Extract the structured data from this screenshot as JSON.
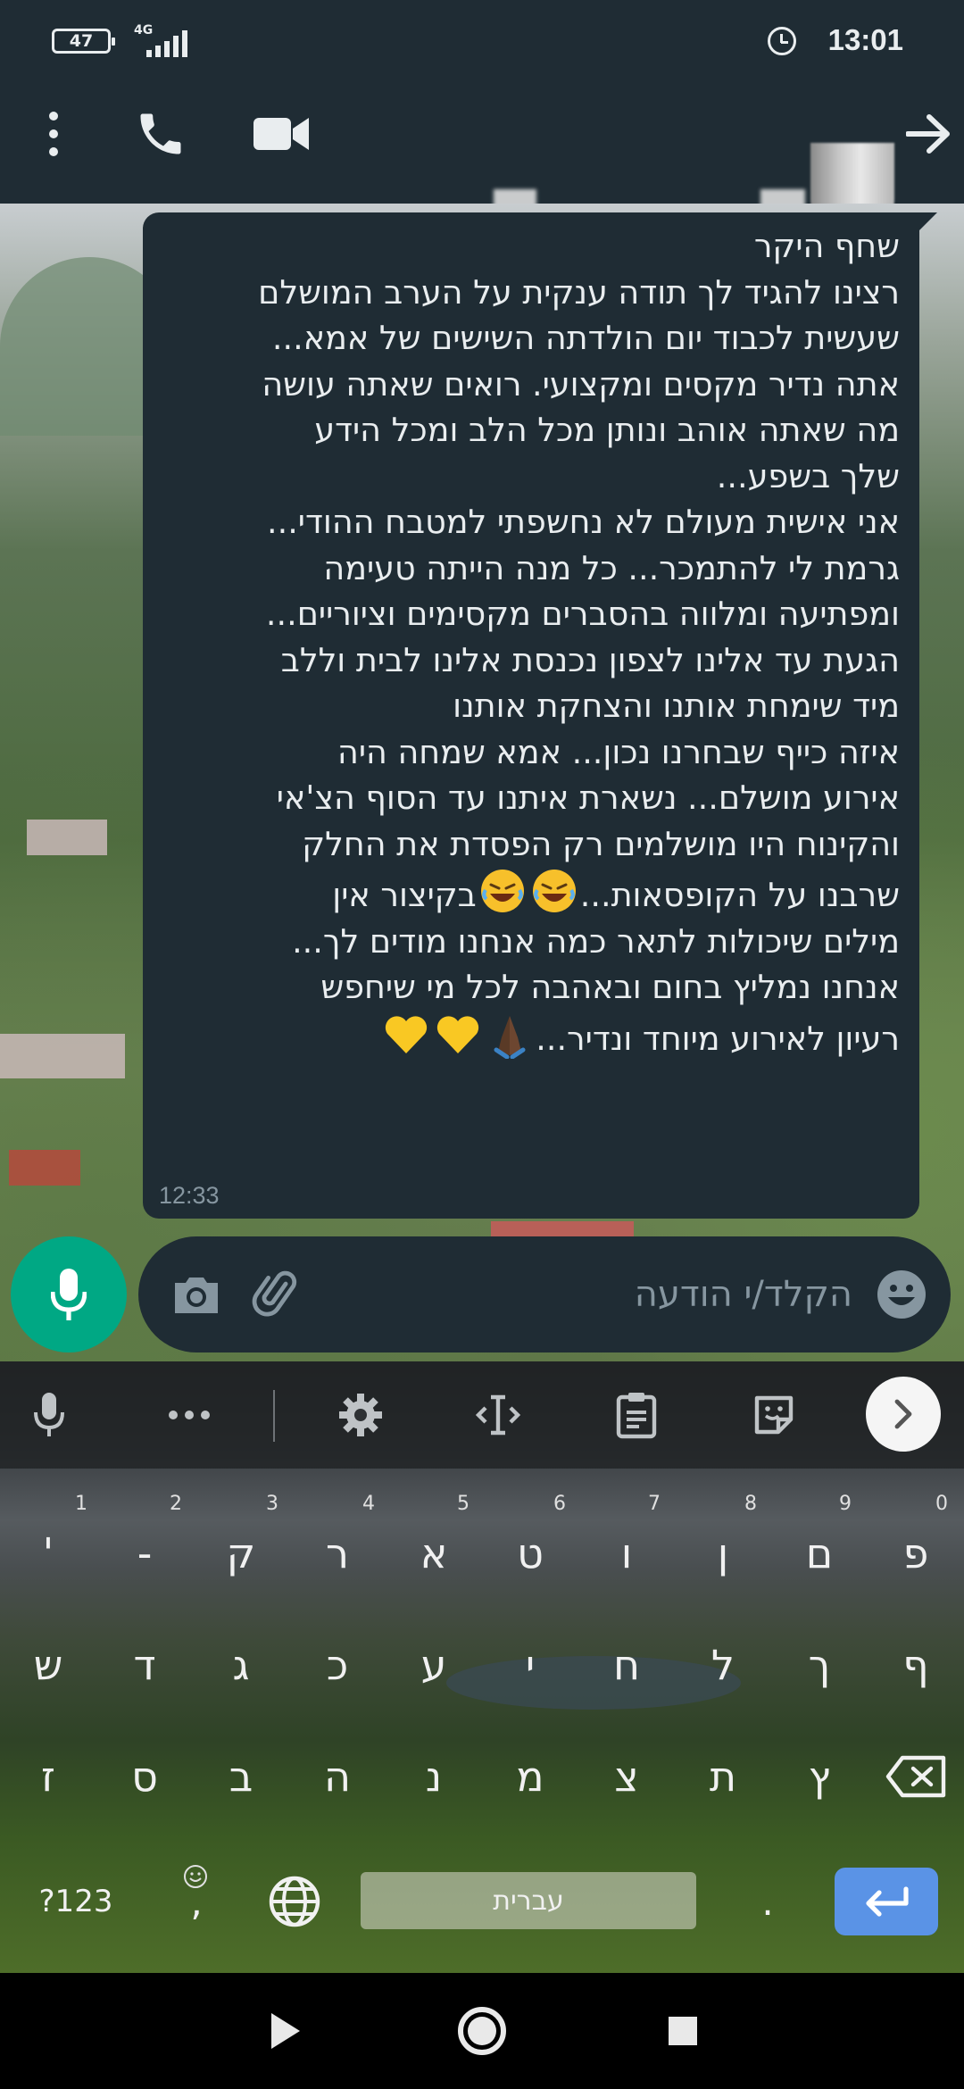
{
  "status_bar": {
    "battery": "47",
    "network": "4G",
    "time": "13:01"
  },
  "header": {
    "contact_name": "",
    "back_icon": "arrow-right-icon",
    "video_icon": "video-camera-icon",
    "call_icon": "phone-icon",
    "menu_icon": "kebab-menu-icon"
  },
  "message": {
    "time": "12:33",
    "lines": [
      "שחף היקר",
      "רצינו להגיד לך תודה ענקית על הערב המושלם",
      "שעשית לכבוד יום הולדתה השישים של אמא...",
      "אתה נדיר מקסים ומקצועי. רואים שאתה עושה",
      "מה שאתה אוהב ונותן מכל הלב ומכל הידע",
      "שלך בשפע...",
      "אני אישית מעולם לא נחשפתי למטבח ההודי...",
      "גרמת לי להתמכר... כל מנה הייתה טעימה",
      "ומפתיעה ומלווה בהסברים מקסימים וציוריים...",
      "הגעת עד אלינו לצפון נכנסת אלינו לבית וללב",
      "מיד שימחת אותנו והצחקת אותנו",
      "איזה כייף שבחרנו נכון... אמא שמחה היה",
      "אירוע מושלם...  נשארת איתנו עד הסוף הצ'אי",
      "והקינוח היו מושלמים רק הפסדת את החלק",
      "שרבנו על הקופסאות...",
      "בקיצור אין",
      "מילים שיכולות לתאר כמה אנחנו מודים לך...",
      "אנחנו נמליץ בחום ובאהבה לכל מי שיחפש",
      "רעיון לאירוע מיוחד ונדיר..."
    ],
    "emoji_line_15": [
      "rofl-emoji",
      "rofl-emoji"
    ],
    "emoji_line_19": [
      "folded-hands-dark-emoji",
      "yellow-heart-emoji",
      "yellow-heart-emoji"
    ]
  },
  "composer": {
    "placeholder": "הקלד/י הודעה",
    "emoji_icon": "smiley-icon",
    "attach_icon": "paperclip-icon",
    "camera_icon": "camera-icon",
    "mic_icon": "microphone-icon",
    "accent_color": "#00a884"
  },
  "keyboard": {
    "toolbar_icons": [
      "microphone-icon",
      "more-icon",
      "gear-icon",
      "cursor-icon",
      "clipboard-icon",
      "sticker-icon",
      "chevron-right-icon"
    ],
    "row1": [
      "פ",
      "ם",
      "ן",
      "ו",
      "ט",
      "א",
      "ר",
      "ק",
      "-",
      "'"
    ],
    "row1_hints": [
      "0",
      "9",
      "8",
      "7",
      "6",
      "5",
      "4",
      "3",
      "2",
      "1"
    ],
    "row2": [
      "ף",
      "ך",
      "ל",
      "ח",
      "י",
      "ע",
      "כ",
      "ג",
      "ד",
      "ש"
    ],
    "row3": [
      "ץ",
      "ת",
      "צ",
      "מ",
      "נ",
      "ה",
      "ב",
      "ס",
      "ז"
    ],
    "symbols_key": "?123",
    "comma_key": ",",
    "period_key": ".",
    "space_label": "עברית",
    "enter_color": "#5a93e6"
  },
  "nav_bar": {
    "back_icon": "triangle-back-icon",
    "home_icon": "circle-home-icon",
    "recents_icon": "square-recents-icon"
  }
}
